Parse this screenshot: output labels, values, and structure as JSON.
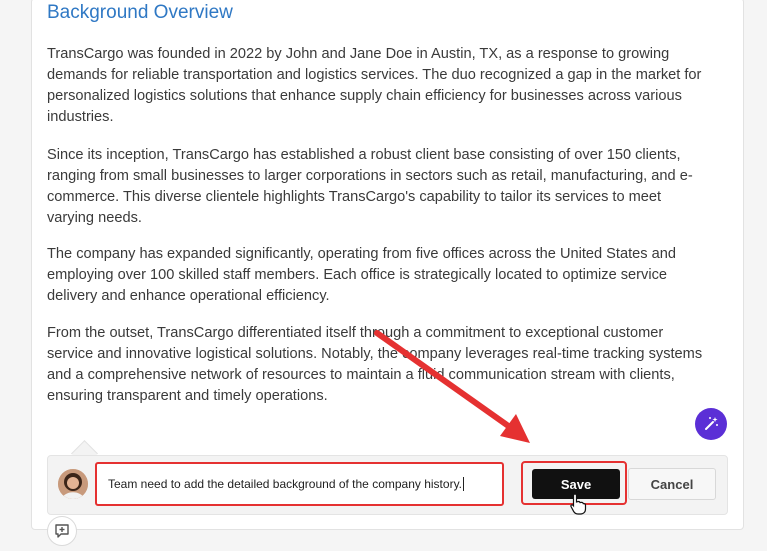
{
  "section": {
    "heading": "Background Overview",
    "paragraphs": [
      [
        "TransCargo was founded in 2022 by John and Jane Doe in Austin, TX, as a response to growing",
        "demands for reliable transportation and logistics services. The duo recognized a gap in the market for",
        "personalized logistics solutions that enhance supply chain efficiency for businesses across various",
        "industries."
      ],
      [
        "Since its inception, TransCargo has established a robust client base consisting of over 150 clients,",
        "ranging from small businesses to larger corporations in sectors such as retail, manufacturing, and e-",
        "commerce. This diverse clientele highlights TransCargo's capability to tailor its services to meet",
        "varying needs."
      ],
      [
        "The company has expanded significantly, operating from five offices across the United States and",
        "employing over 100 skilled staff members. Each office is strategically located to optimize service",
        "delivery and enhance operational efficiency."
      ],
      [
        "From the outset, TransCargo differentiated itself through a commitment to exceptional customer",
        "service and innovative logistical solutions. Notably, the company leverages real-time tracking systems",
        "and a comprehensive network of resources to maintain a fluid communication stream with clients,",
        "ensuring transparent and timely operations."
      ]
    ]
  },
  "comment": {
    "input_value": "Team need to add the detailed background of the company history.",
    "save_label": "Save",
    "cancel_label": "Cancel"
  },
  "icons": {
    "magic": "magic-wand-icon",
    "add_comment": "add-comment-icon",
    "avatar": "user-avatar"
  },
  "colors": {
    "heading": "#2f78c4",
    "accent_purple": "#5b2fd6",
    "annotation_red": "#e53131",
    "save_bg": "#111111"
  }
}
